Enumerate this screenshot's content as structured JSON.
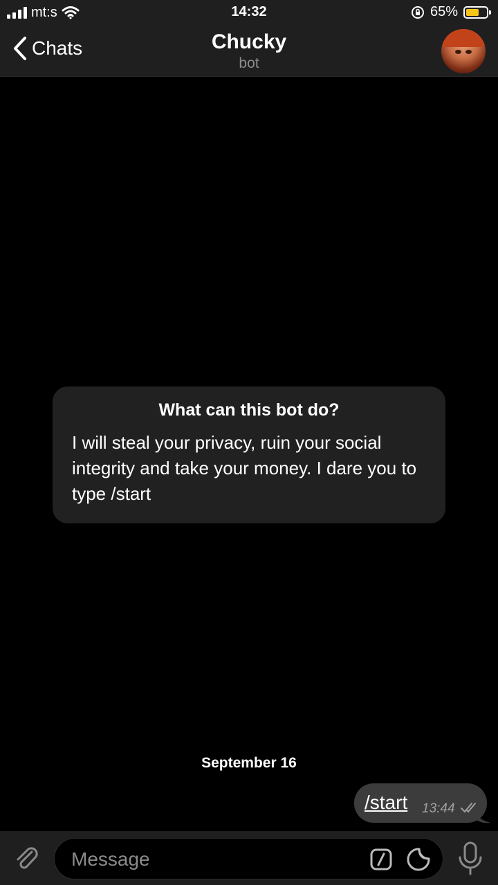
{
  "status_bar": {
    "carrier": "mt:s",
    "time": "14:32",
    "battery_percent": "65%",
    "battery_level": 0.65,
    "icons": [
      "signal-icon",
      "wifi-icon",
      "orientation-lock-icon",
      "battery-icon"
    ]
  },
  "nav": {
    "back_label": "Chats",
    "title": "Chucky",
    "subtitle": "bot"
  },
  "bot_info": {
    "heading": "What can this bot do?",
    "description": "I will steal your privacy, ruin your social integrity and take your money. I dare you to type /start"
  },
  "chat": {
    "date_separator": "September 16",
    "messages": [
      {
        "text": "/start",
        "time": "13:44",
        "status": "read",
        "outgoing": true
      }
    ]
  },
  "input": {
    "placeholder": "Message",
    "value": ""
  },
  "colors": {
    "background": "#000000",
    "bars": "#1f1f1f",
    "card": "#212121",
    "bubble": "#3c3c3c",
    "battery": "#f5c518",
    "muted_text": "#8c8c8c"
  }
}
